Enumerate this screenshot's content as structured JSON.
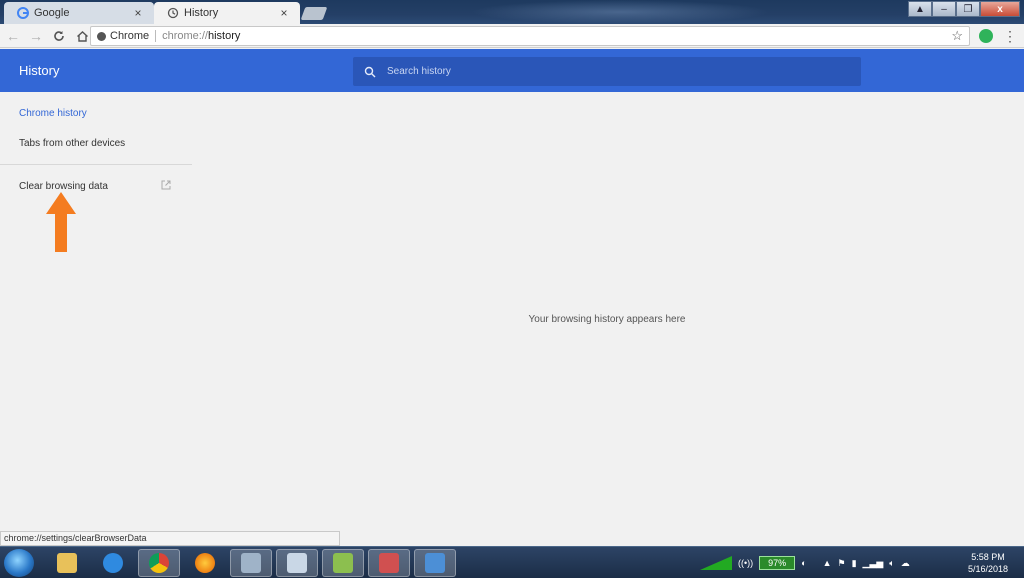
{
  "tabs": [
    {
      "title": "Google",
      "close": "×",
      "icon": "google-g-icon"
    },
    {
      "title": "History",
      "close": "×",
      "icon": "history-clock-icon"
    }
  ],
  "toolbar": {
    "secure_label": "Chrome",
    "url_scheme": "chrome://",
    "url_path": "history"
  },
  "history": {
    "title": "History",
    "search_placeholder": "Search history",
    "sidebar": {
      "chrome_history": "Chrome history",
      "tabs_other_devices": "Tabs from other devices",
      "clear_browsing_data": "Clear browsing data"
    },
    "empty_message": "Your browsing history appears here"
  },
  "status_url": "chrome://settings/clearBrowserData",
  "taskbar": {
    "battery": "97%",
    "time": "5:58 PM",
    "date": "5/16/2018"
  },
  "colors": {
    "accent": "#3367d6",
    "arrow": "#f47c20"
  }
}
